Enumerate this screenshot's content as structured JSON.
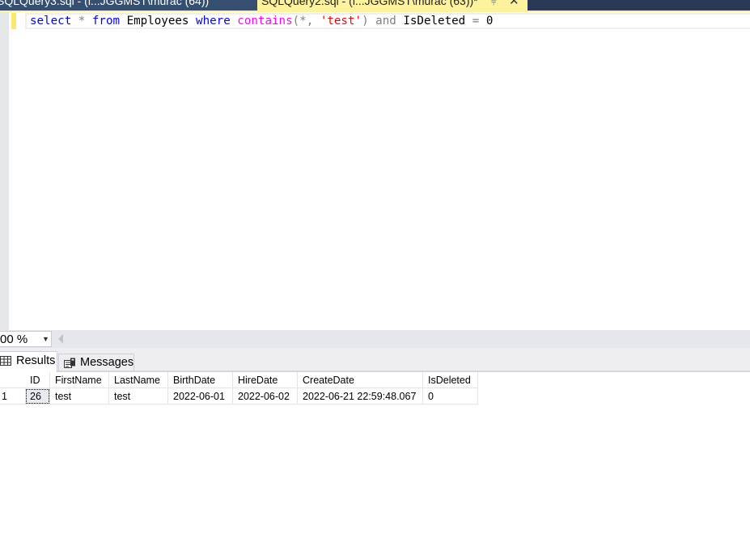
{
  "document_tabs": [
    {
      "label": "SQLQuery3.sql - (l...JGGMST\\murac (64))",
      "active": false
    },
    {
      "label": "SQLQuery2.sql - (l...JGGMST\\murac (63))*",
      "active": true,
      "pin_icon": "pin-icon",
      "close_icon": "close-icon"
    }
  ],
  "editor": {
    "query_tokens": [
      {
        "text": "select",
        "type": "keyword"
      },
      {
        "text": " ",
        "type": "plain"
      },
      {
        "text": "*",
        "type": "operator"
      },
      {
        "text": " ",
        "type": "plain"
      },
      {
        "text": "from",
        "type": "keyword"
      },
      {
        "text": " Employees ",
        "type": "plain"
      },
      {
        "text": "where",
        "type": "keyword"
      },
      {
        "text": " ",
        "type": "plain"
      },
      {
        "text": "contains",
        "type": "function"
      },
      {
        "text": "(*,",
        "type": "operator"
      },
      {
        "text": " ",
        "type": "plain"
      },
      {
        "text": "'test'",
        "type": "string"
      },
      {
        "text": ")",
        "type": "operator"
      },
      {
        "text": " ",
        "type": "plain"
      },
      {
        "text": "and",
        "type": "operator"
      },
      {
        "text": " IsDeleted ",
        "type": "plain"
      },
      {
        "text": "=",
        "type": "operator"
      },
      {
        "text": " 0",
        "type": "plain"
      }
    ]
  },
  "statusbar": {
    "zoom_level": "00 %",
    "zoom_dropdown_icon": "caret-down-icon",
    "scroll_left_icon": "scroll-left-icon"
  },
  "results_panel": {
    "tabs": [
      {
        "label": "Results",
        "icon": "grid-icon",
        "active": true
      },
      {
        "label": "Messages",
        "icon": "messages-icon",
        "active": false
      }
    ],
    "columns": [
      "ID",
      "FirstName",
      "LastName",
      "BirthDate",
      "HireDate",
      "CreateDate",
      "IsDeleted"
    ],
    "rows": [
      {
        "row_number": "1",
        "cells": [
          "26",
          "test",
          "test",
          "2022-06-01",
          "2022-06-02",
          "2022-06-21 22:59:48.067",
          "0"
        ]
      }
    ]
  },
  "colors": {
    "tabbar_bg": "#293955",
    "active_tab_bg": "#fff29d",
    "keyword": "#0000ff",
    "function": "#ff00ff",
    "string": "#ff0000",
    "operator": "#808080"
  }
}
